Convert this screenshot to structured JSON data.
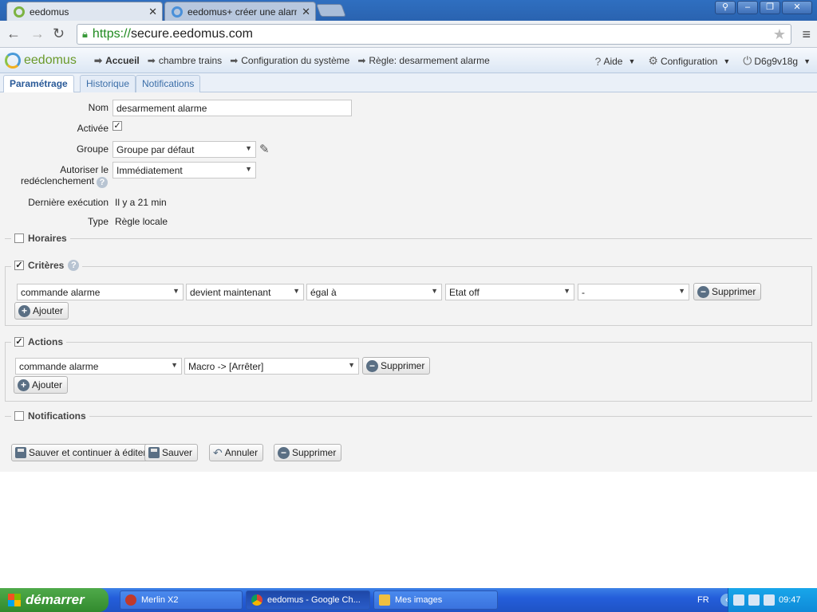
{
  "browser": {
    "tabs": [
      {
        "label": "eedomus",
        "active": true
      },
      {
        "label": "eedomus+ créer une alarme",
        "active": false
      }
    ],
    "url_scheme": "https://",
    "url_host": "secure.eedomus.com",
    "window_buttons": [
      "person-icon",
      "minimize-icon",
      "restore-icon",
      "close-icon"
    ]
  },
  "header": {
    "logo": "eedomus",
    "breadcrumbs": [
      "Accueil",
      "chambre trains",
      "Configuration du système",
      "Règle: desarmement alarme"
    ],
    "help_label": "Aide",
    "config_label": "Configuration",
    "user_label": "D6g9v18g"
  },
  "page_tabs": [
    "Paramétrage",
    "Historique",
    "Notifications"
  ],
  "form": {
    "nom_label": "Nom",
    "nom_value": "desarmement alarme",
    "activee_label": "Activée",
    "activee_checked": true,
    "groupe_label": "Groupe",
    "groupe_value": "Groupe par défaut",
    "autoriser_label_1": "Autoriser le",
    "autoriser_label_2": "redéclenchement",
    "autoriser_value": "Immédiatement",
    "derniere_label": "Dernière exécution",
    "derniere_value": "Il y a 21 min",
    "type_label": "Type",
    "type_value": "Règle locale"
  },
  "sections": {
    "horaires": {
      "label": "Horaires",
      "checked": false
    },
    "criteres": {
      "label": "Critères",
      "checked": true,
      "row": [
        "commande alarme",
        "devient maintenant",
        "égal à",
        "Etat off",
        "-"
      ],
      "delete_label": "Supprimer",
      "add_label": "Ajouter"
    },
    "actions": {
      "label": "Actions",
      "checked": true,
      "row": [
        "commande alarme",
        "Macro -> [Arrêter]"
      ],
      "delete_label": "Supprimer",
      "add_label": "Ajouter"
    },
    "notifications": {
      "label": "Notifications",
      "checked": false
    }
  },
  "footer_buttons": {
    "save_continue": "Sauver et continuer à éditer",
    "save": "Sauver",
    "cancel": "Annuler",
    "delete": "Supprimer"
  },
  "taskbar": {
    "start_label": "démarrer",
    "tasks": [
      "Merlin X2",
      "eedomus - Google Ch...",
      "Mes images"
    ],
    "lang": "FR",
    "clock": "09:47"
  },
  "colors": {
    "accent": "#2a5a98",
    "header_bg": "#dce7f4",
    "form_bg": "#f3f3f3"
  }
}
